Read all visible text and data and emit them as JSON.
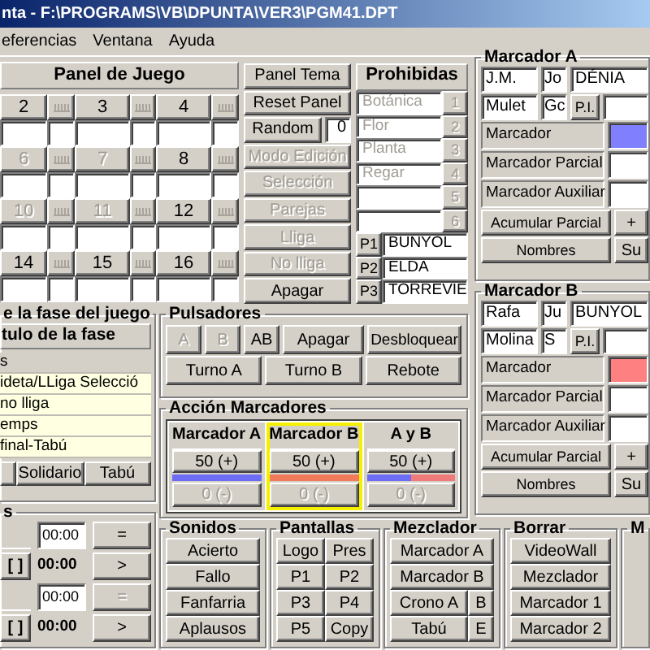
{
  "window": {
    "title": "nta - F:\\PROGRAMS\\VB\\DPUNTA\\VER3\\PGM41.DPT"
  },
  "menu": [
    "eferencias",
    "Ventana",
    "Ayuda"
  ],
  "panel_de_juego": {
    "title": "Panel de Juego",
    "cells": [
      {
        "number": "2",
        "disabled": false
      },
      {
        "number": "3",
        "disabled": false
      },
      {
        "number": "4",
        "disabled": false
      },
      {
        "number": "6",
        "disabled": true
      },
      {
        "number": "7",
        "disabled": true
      },
      {
        "number": "8",
        "disabled": false
      },
      {
        "number": "10",
        "disabled": true
      },
      {
        "number": "11",
        "disabled": true
      },
      {
        "number": "12",
        "disabled": false
      },
      {
        "number": "14",
        "disabled": false
      },
      {
        "number": "15",
        "disabled": false
      },
      {
        "number": "16",
        "disabled": false
      }
    ]
  },
  "panel_buttons": [
    {
      "kind": "button",
      "label": "Panel Tema",
      "disabled": false
    },
    {
      "kind": "button",
      "label": "Reset Panel",
      "disabled": false
    },
    {
      "kind": "random",
      "label": "Random",
      "value": "0",
      "disabled": false
    },
    {
      "kind": "button",
      "label": "Modo Edición",
      "disabled": true
    },
    {
      "kind": "button",
      "label": "Selección",
      "disabled": true
    },
    {
      "kind": "button",
      "label": "Parejas",
      "disabled": true
    },
    {
      "kind": "button",
      "label": "Lliga",
      "disabled": true
    },
    {
      "kind": "button",
      "label": "No lliga",
      "disabled": true
    },
    {
      "kind": "button",
      "label": "Apagar",
      "disabled": false
    }
  ],
  "prohibidas": {
    "title": "Prohibidas",
    "words": [
      {
        "text": "Botánica",
        "number": "1"
      },
      {
        "text": "Flor",
        "number": "2"
      },
      {
        "text": "Planta",
        "number": "3"
      },
      {
        "text": "Regar",
        "number": "4"
      },
      {
        "number": "5"
      },
      {
        "number": "6"
      }
    ],
    "players": [
      {
        "label": "P1",
        "value": "BUNYOL"
      },
      {
        "label": "P2",
        "value": "ELDA"
      },
      {
        "label": "P3",
        "value": "TORREVIE"
      }
    ]
  },
  "marcadores": [
    {
      "title": "Marcador A",
      "first_name": "J.M.",
      "first_name_2": "Jo",
      "team": "DÉNIA",
      "last_name": "Mulet",
      "last_name_2": "Gc",
      "pi": "P.I.",
      "rows": [
        {
          "label": "Marcador",
          "color": "#8080ff"
        },
        {
          "label": "Marcador Parcial"
        },
        {
          "label": "Marcador Auxiliar"
        }
      ],
      "accumulate": "Acumular Parcial",
      "plus": "+",
      "names": "Nombres",
      "extra": "Su"
    },
    {
      "title": "Marcador B",
      "first_name": "Rafa",
      "first_name_2": "Ju",
      "team": "BUNYOL",
      "last_name": "Molina",
      "last_name_2": "S",
      "pi": "P.I.",
      "rows": [
        {
          "label": "Marcador",
          "color": "#ff8080"
        },
        {
          "label": "Marcador Parcial"
        },
        {
          "label": "Marcador Auxiliar"
        }
      ],
      "accumulate": "Acumular Parcial",
      "plus": "+",
      "names": "Nombres",
      "extra": "Su"
    }
  ],
  "fase": {
    "title": "e la fase del juego",
    "header": "tulo de la fase",
    "items": [
      {
        "text": "s",
        "highlighted": false
      },
      {
        "text": "ideta/LLiga Selecció",
        "highlighted": true
      },
      {
        "text": "no lliga",
        "highlighted": true
      },
      {
        "text": "emps",
        "highlighted": true
      },
      {
        "text": "final-Tabú",
        "highlighted": true
      }
    ],
    "buttons": [
      "Solidario",
      "Tabú"
    ]
  },
  "timers": {
    "title": "s",
    "rows": [
      {
        "kind": "field",
        "time": "00:00",
        "button": "=",
        "disabled": false
      },
      {
        "kind": "bracket",
        "bracket": "[ ]",
        "time": "00:00",
        "button": ">",
        "disabled": false
      },
      {
        "kind": "field",
        "time": "00:00",
        "button": "=",
        "disabled": true
      },
      {
        "kind": "bracket",
        "bracket": "[ ]",
        "time": "00:00",
        "button": ">",
        "disabled": false
      }
    ]
  },
  "pulsadores": {
    "title": "Pulsadores",
    "row_1": [
      {
        "label": "A",
        "disabled": true
      },
      {
        "label": "B",
        "disabled": true
      },
      {
        "label": "AB",
        "disabled": false
      },
      {
        "label": "Apagar",
        "disabled": false
      },
      {
        "label": "Desbloquear",
        "disabled": false
      }
    ],
    "row_2": [
      {
        "label": "Turno A",
        "disabled": false
      },
      {
        "label": "Turno B",
        "disabled": false
      },
      {
        "label": "Rebote",
        "disabled": false
      }
    ]
  },
  "accion": {
    "title": "Acción Marcadores",
    "columns": [
      {
        "title": "Marcador A",
        "plus": "50 (+)",
        "minus": "0 (-)",
        "selected": false,
        "kind": "first"
      },
      {
        "title": "Marcador B",
        "plus": "50 (+)",
        "minus": "0 (-)",
        "selected": true,
        "kind": "second"
      },
      {
        "title": "A y B",
        "plus": "50 (+)",
        "minus": "0 (-)",
        "selected": false,
        "kind": "both"
      }
    ]
  },
  "bottom_groups": [
    {
      "title": "Sonidos",
      "rows": [
        [
          "Acierto"
        ],
        [
          "Fallo"
        ],
        [
          "Fanfarria"
        ],
        [
          "Aplausos"
        ]
      ]
    },
    {
      "title": "Pantallas",
      "rows": [
        [
          "Logo",
          "Pres"
        ],
        [
          "P1",
          "P2"
        ],
        [
          "P3",
          "P4"
        ],
        [
          "P5",
          "Copy"
        ]
      ]
    },
    {
      "title": "Mezclador",
      "rows": [
        [
          "Marcador A"
        ],
        [
          "Marcador B"
        ],
        [
          "Crono A",
          "B"
        ],
        [
          "Tabú",
          "E"
        ]
      ]
    },
    {
      "title": "Borrar",
      "rows": [
        [
          "VideoWall"
        ],
        [
          "Mezclador"
        ],
        [
          "Marcador 1"
        ],
        [
          "Marcador 2"
        ]
      ]
    },
    {
      "title": "M"
    }
  ]
}
